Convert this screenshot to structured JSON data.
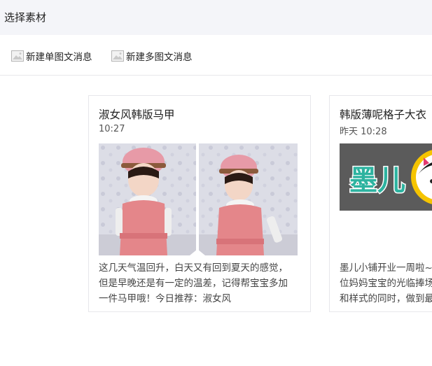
{
  "header": {
    "title": "选择素材"
  },
  "toolbar": {
    "new_single": "新建单图文消息",
    "new_multi": "新建多图文消息"
  },
  "cards": [
    {
      "title": "淑女风韩版马甲",
      "time": "10:27",
      "desc": "这几天气温回升，白天又有回到夏天的感觉，\n但是早晚还是有一定的温差，记得帮宝宝多加\n一件马甲哦！今日推荐：淑女风"
    },
    {
      "title": "韩版薄呢格子大衣",
      "time": "昨天 10:28",
      "cover_text": "墨儿",
      "desc": "墨儿小铺开业一周啦~\n位妈妈宝宝的光临捧场\n和样式的同时，做到最"
    }
  ],
  "colors": {
    "header_bg": "#f4f5f9",
    "border": "#e7e7eb",
    "logo_bg": "#5b5b5b",
    "logo_green": "#2db3a0",
    "logo_yellow": "#f5c400"
  }
}
